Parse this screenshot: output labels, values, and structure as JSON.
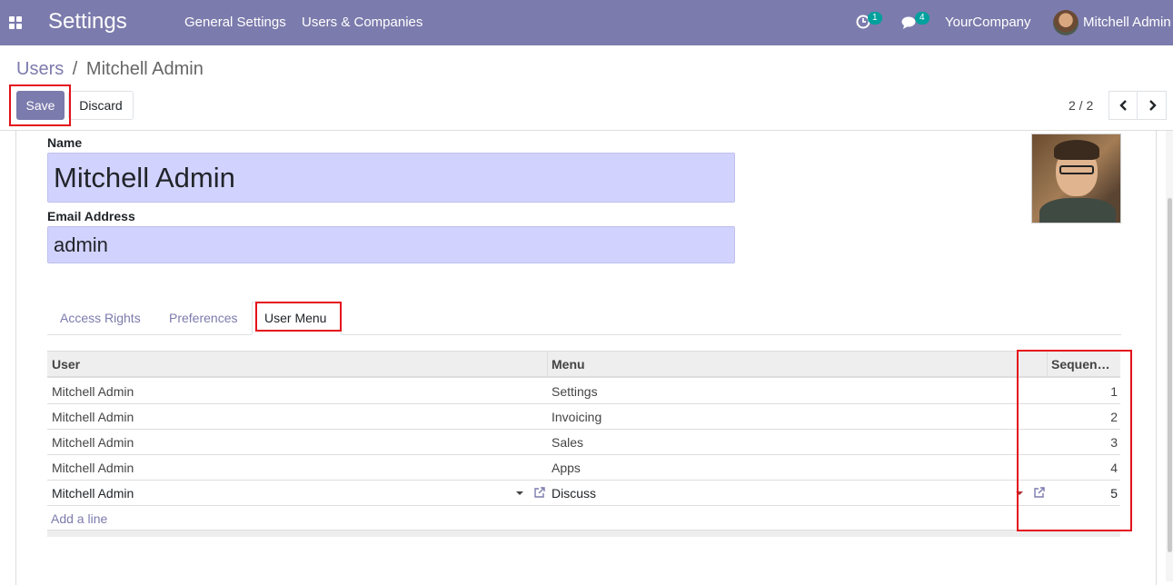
{
  "navbar": {
    "app_title": "Settings",
    "menus": [
      "General Settings",
      "Users & Companies"
    ],
    "activity_count": "1",
    "messages_count": "4",
    "company": "YourCompany",
    "user": "Mitchell Admin"
  },
  "breadcrumb": {
    "parent": "Users",
    "separator": "/",
    "current": "Mitchell Admin"
  },
  "buttons": {
    "save": "Save",
    "discard": "Discard"
  },
  "pager": {
    "value": "2 / 2",
    "prev": "‹",
    "next": "›"
  },
  "form": {
    "name_label": "Name",
    "name_value": "Mitchell Admin",
    "email_label": "Email Address",
    "email_value": "admin"
  },
  "tabs": [
    "Access Rights",
    "Preferences",
    "User Menu"
  ],
  "active_tab": "User Menu",
  "table": {
    "columns": [
      "User",
      "Menu",
      "Sequen…"
    ],
    "rows": [
      {
        "user": "Mitchell Admin",
        "menu": "Settings",
        "sequence": "1"
      },
      {
        "user": "Mitchell Admin",
        "menu": "Invoicing",
        "sequence": "2"
      },
      {
        "user": "Mitchell Admin",
        "menu": "Sales",
        "sequence": "3"
      },
      {
        "user": "Mitchell Admin",
        "menu": "Apps",
        "sequence": "4"
      },
      {
        "user": "Mitchell Admin",
        "menu": "Discuss",
        "sequence": "5"
      }
    ],
    "add_line": "Add a line"
  },
  "colors": {
    "brand": "#7c7bad",
    "field_bg": "#d2d2ff",
    "highlight": "#e4111b",
    "badge": "#00a09d"
  },
  "icons": [
    "apps-grid-icon",
    "activity-clock-icon",
    "chat-icon",
    "chevron-left-icon",
    "chevron-right-icon",
    "caret-down-icon",
    "external-link-icon"
  ]
}
